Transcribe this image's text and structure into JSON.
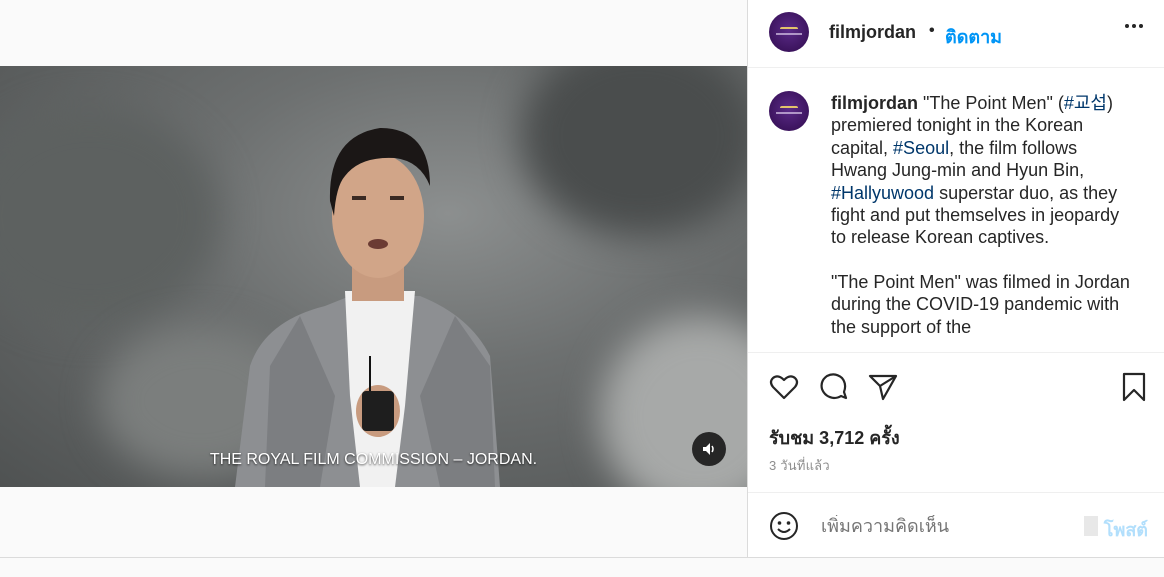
{
  "post": {
    "username": "filmjordan",
    "follow_label": "ติดตาม",
    "dot": "•",
    "video": {
      "subtitle": "THE ROYAL FILM COMMISSION – JORDAN."
    },
    "caption": {
      "username": "filmjordan",
      "t1": " \"The Point Men\" (",
      "h1": "#교섭",
      "t2": ") premiered tonight in the Korean capital, ",
      "h2": "#Seoul",
      "t3": ", the film follows Hwang Jung-min and Hyun Bin, ",
      "h3": "#Hallyuwood",
      "t4": " superstar duo, as they fight and put themselves in jeopardy to release Korean captives.",
      "p2": "\"The Point Men\" was filmed in Jordan during the COVID-19 pandemic with the support of the"
    },
    "likes_text": "รับชม 3,712 ครั้ง",
    "time_ago": "3 วันที่แล้ว",
    "comment_placeholder": "เพิ่มความคิดเห็น",
    "post_button": "โพสต์"
  },
  "colors": {
    "accent": "#0095f6",
    "hashtag": "#00376b",
    "post_disabled": "#b2dffc",
    "avatar": "#4b1d73"
  },
  "icons": [
    "more-options-icon",
    "heart-icon",
    "comment-icon",
    "share-icon",
    "bookmark-icon",
    "emoji-icon",
    "sound-icon"
  ]
}
